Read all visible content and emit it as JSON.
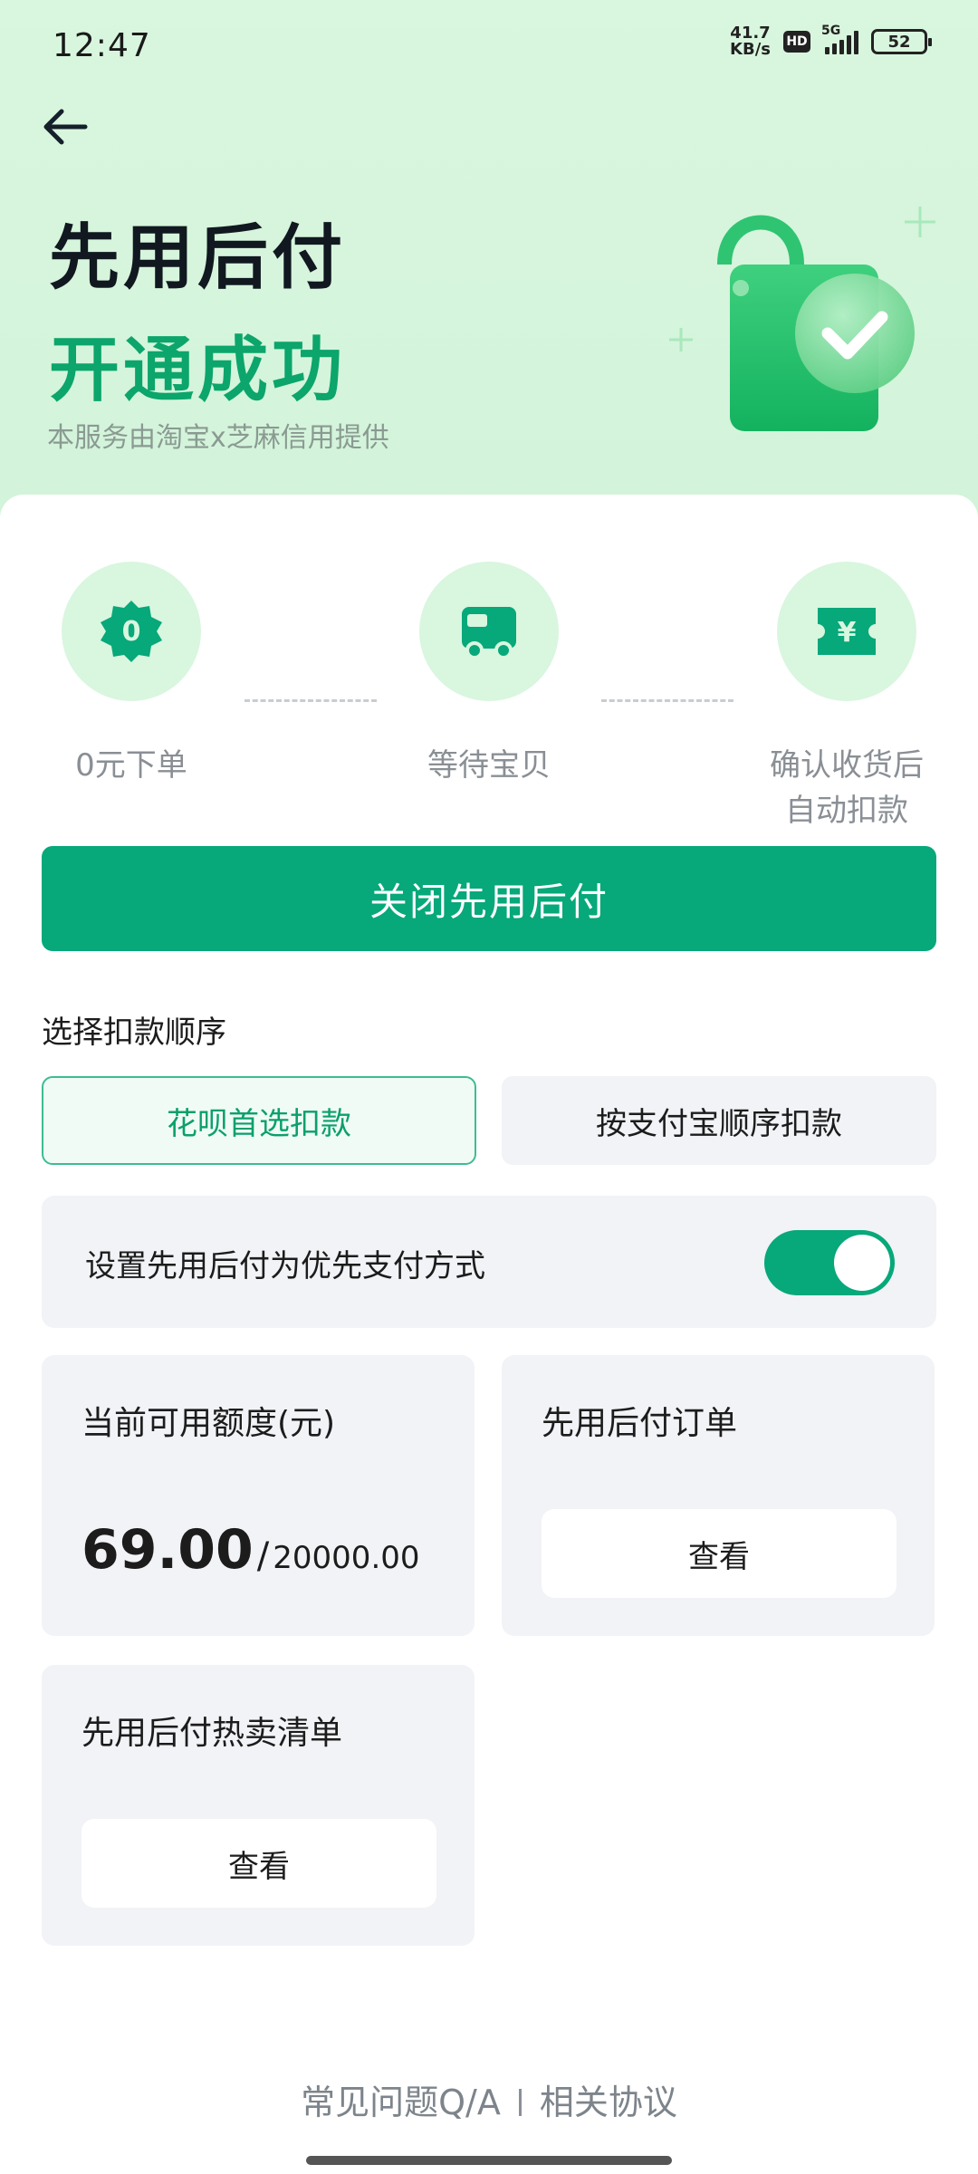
{
  "status_bar": {
    "time": "12:47",
    "net_speed_value": "41.7",
    "net_speed_unit": "KB/s",
    "hd": "HD",
    "signal_label": "5G",
    "battery": "52"
  },
  "header": {
    "title_line1": "先用后付",
    "title_line2": "开通成功",
    "subtitle": "本服务由淘宝x芝麻信用提供"
  },
  "steps": [
    {
      "badge": "0",
      "label_line1": "0元下单",
      "label_line2": "",
      "icon": "zero-badge-icon"
    },
    {
      "label_line1": "等待宝贝",
      "label_line2": "",
      "icon": "truck-icon"
    },
    {
      "label_line1": "确认收货后",
      "label_line2": "自动扣款",
      "icon": "yuan-ticket-icon"
    }
  ],
  "close_button": "关闭先用后付",
  "deduction": {
    "title": "选择扣款顺序",
    "options": [
      "花呗首选扣款",
      "按支付宝顺序扣款"
    ],
    "selected_index": 0
  },
  "priority_toggle": {
    "label": "设置先用后付为优先支付方式",
    "on": true
  },
  "quota_card": {
    "title": "当前可用额度(元)",
    "available": "69.00",
    "slash": "/",
    "total": "20000.00"
  },
  "orders_card": {
    "title": "先用后付订单",
    "button": "查看"
  },
  "hot_card": {
    "title": "先用后付热卖清单",
    "button": "查看"
  },
  "footer": {
    "faq": "常见问题Q/A",
    "agreement": "相关协议"
  },
  "colors": {
    "accent": "#07a87a",
    "hero_bg": "#d9f6de",
    "title_green": "#0ca56b"
  }
}
